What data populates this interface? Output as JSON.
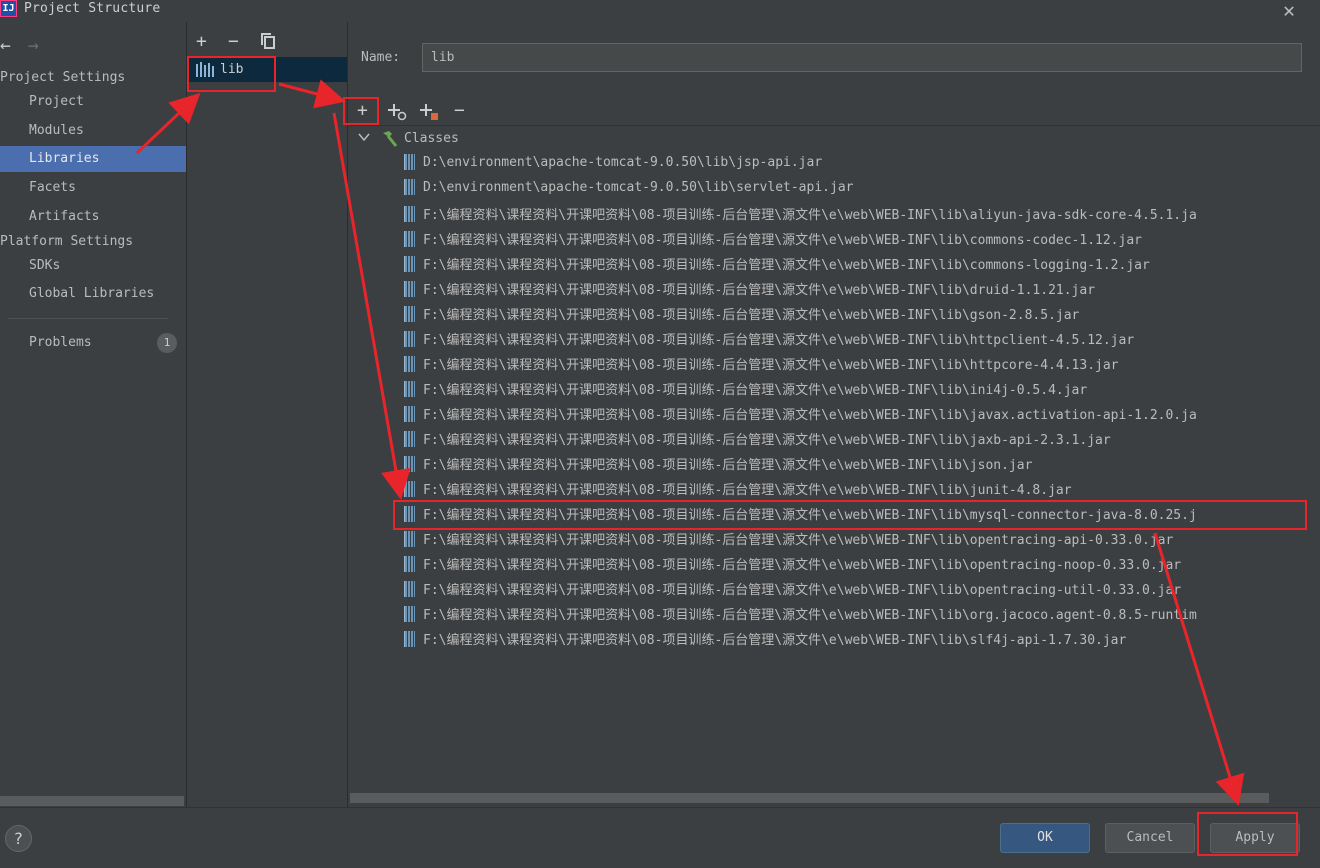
{
  "window": {
    "icon_text": "IJ",
    "title": "Project Structure",
    "close_glyph": "✕"
  },
  "nav": {
    "back_glyph": "←",
    "forward_glyph": "→",
    "project_settings_header": "Project Settings",
    "project_items": [
      "Project",
      "Modules",
      "Libraries",
      "Facets",
      "Artifacts"
    ],
    "selected": "Libraries",
    "platform_settings_header": "Platform Settings",
    "platform_items": [
      "SDKs",
      "Global Libraries"
    ],
    "problems_label": "Problems",
    "problems_count": "1"
  },
  "library_list": {
    "toolbar": [
      "+",
      "−",
      "copy-icon"
    ],
    "items": [
      "lib"
    ]
  },
  "detail": {
    "name_label": "Name:",
    "name_value": "lib",
    "toolbar": [
      "add-icon",
      "add-jar-icon",
      "add-file-icon",
      "remove-icon"
    ],
    "classes_label": "Classes",
    "jars": [
      "D:\\environment\\apache-tomcat-9.0.50\\lib\\jsp-api.jar",
      "D:\\environment\\apache-tomcat-9.0.50\\lib\\servlet-api.jar",
      "F:\\编程资料\\课程资料\\开课吧资料\\08-项目训练-后台管理\\源文件\\e\\web\\WEB-INF\\lib\\aliyun-java-sdk-core-4.5.1.ja",
      "F:\\编程资料\\课程资料\\开课吧资料\\08-项目训练-后台管理\\源文件\\e\\web\\WEB-INF\\lib\\commons-codec-1.12.jar",
      "F:\\编程资料\\课程资料\\开课吧资料\\08-项目训练-后台管理\\源文件\\e\\web\\WEB-INF\\lib\\commons-logging-1.2.jar",
      "F:\\编程资料\\课程资料\\开课吧资料\\08-项目训练-后台管理\\源文件\\e\\web\\WEB-INF\\lib\\druid-1.1.21.jar",
      "F:\\编程资料\\课程资料\\开课吧资料\\08-项目训练-后台管理\\源文件\\e\\web\\WEB-INF\\lib\\gson-2.8.5.jar",
      "F:\\编程资料\\课程资料\\开课吧资料\\08-项目训练-后台管理\\源文件\\e\\web\\WEB-INF\\lib\\httpclient-4.5.12.jar",
      "F:\\编程资料\\课程资料\\开课吧资料\\08-项目训练-后台管理\\源文件\\e\\web\\WEB-INF\\lib\\httpcore-4.4.13.jar",
      "F:\\编程资料\\课程资料\\开课吧资料\\08-项目训练-后台管理\\源文件\\e\\web\\WEB-INF\\lib\\ini4j-0.5.4.jar",
      "F:\\编程资料\\课程资料\\开课吧资料\\08-项目训练-后台管理\\源文件\\e\\web\\WEB-INF\\lib\\javax.activation-api-1.2.0.ja",
      "F:\\编程资料\\课程资料\\开课吧资料\\08-项目训练-后台管理\\源文件\\e\\web\\WEB-INF\\lib\\jaxb-api-2.3.1.jar",
      "F:\\编程资料\\课程资料\\开课吧资料\\08-项目训练-后台管理\\源文件\\e\\web\\WEB-INF\\lib\\json.jar",
      "F:\\编程资料\\课程资料\\开课吧资料\\08-项目训练-后台管理\\源文件\\e\\web\\WEB-INF\\lib\\junit-4.8.jar",
      "F:\\编程资料\\课程资料\\开课吧资料\\08-项目训练-后台管理\\源文件\\e\\web\\WEB-INF\\lib\\mysql-connector-java-8.0.25.j",
      "F:\\编程资料\\课程资料\\开课吧资料\\08-项目训练-后台管理\\源文件\\e\\web\\WEB-INF\\lib\\opentracing-api-0.33.0.jar",
      "F:\\编程资料\\课程资料\\开课吧资料\\08-项目训练-后台管理\\源文件\\e\\web\\WEB-INF\\lib\\opentracing-noop-0.33.0.jar",
      "F:\\编程资料\\课程资料\\开课吧资料\\08-项目训练-后台管理\\源文件\\e\\web\\WEB-INF\\lib\\opentracing-util-0.33.0.jar",
      "F:\\编程资料\\课程资料\\开课吧资料\\08-项目训练-后台管理\\源文件\\e\\web\\WEB-INF\\lib\\org.jacoco.agent-0.8.5-runtim",
      "F:\\编程资料\\课程资料\\开课吧资料\\08-项目训练-后台管理\\源文件\\e\\web\\WEB-INF\\lib\\slf4j-api-1.7.30.jar"
    ],
    "highlighted_jar": "mysql-connector-java-8.0.25"
  },
  "footer": {
    "help_glyph": "?",
    "ok": "OK",
    "cancel": "Cancel",
    "apply": "Apply"
  },
  "colors": {
    "background": "#3c3f41",
    "selection": "#4b6eaf",
    "list_selection": "#0d293e",
    "primary_button": "#365880",
    "annotation": "#e8252b"
  }
}
